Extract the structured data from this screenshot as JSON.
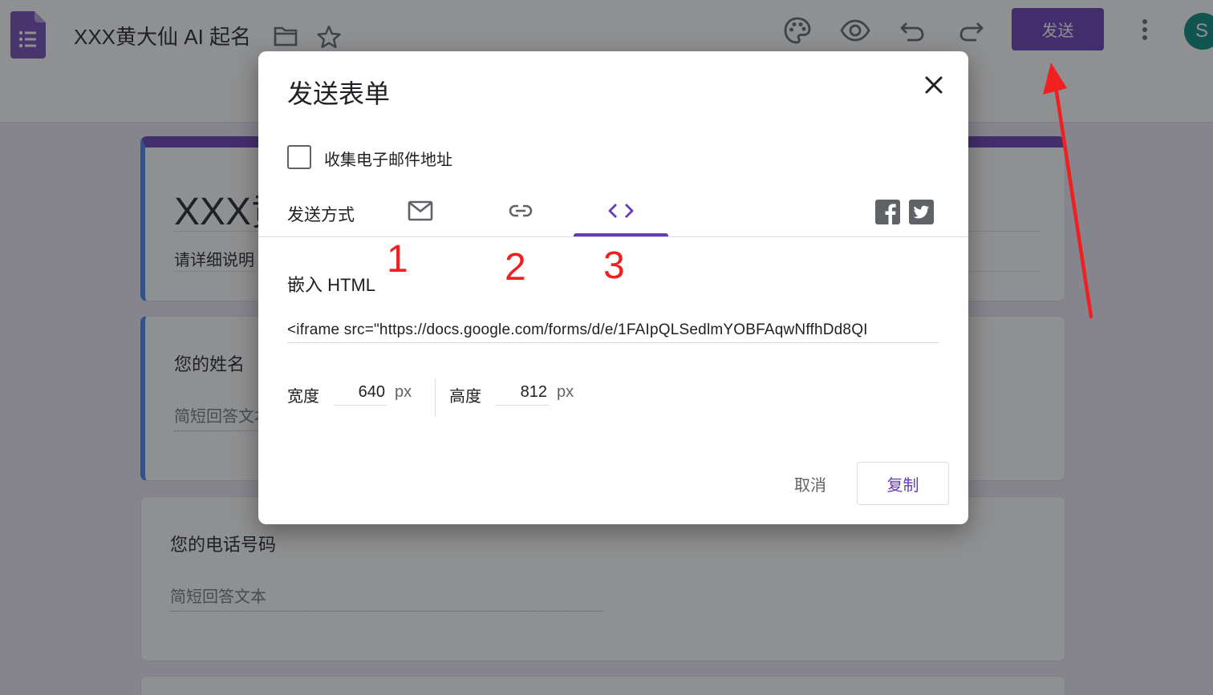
{
  "header": {
    "doc_title": "XXX黄大仙 AI 起名",
    "send_label": "发送",
    "avatar_letter": "S",
    "icons": [
      "forms-app-icon",
      "folder-icon",
      "star-icon",
      "palette-icon",
      "preview-eye-icon",
      "undo-icon",
      "redo-icon",
      "more-vert-icon"
    ]
  },
  "form": {
    "title": "XXX黄大仙 AI 起名",
    "description": "请详细说明",
    "questions": [
      {
        "title": "您的姓名",
        "placeholder": "简短回答文本"
      },
      {
        "title": "您的电话号码",
        "placeholder": "简短回答文本"
      }
    ]
  },
  "dialog": {
    "title": "发送表单",
    "collect_email_label": "收集电子邮件地址",
    "send_via_label": "发送方式",
    "tabs": [
      {
        "name": "email",
        "icon": "mail-icon"
      },
      {
        "name": "link",
        "icon": "link-icon"
      },
      {
        "name": "embed",
        "icon": "code-icon",
        "selected": true
      }
    ],
    "social": [
      "facebook-icon",
      "twitter-icon"
    ],
    "embed_label": "嵌入 HTML",
    "embed_code": "<iframe src=\"https://docs.google.com/forms/d/e/1FAIpQLSedlmYOBFAqwNffhDd8QI",
    "width_label": "宽度",
    "width_value": "640",
    "height_label": "高度",
    "height_value": "812",
    "unit": "px",
    "cancel_label": "取消",
    "copy_label": "复制"
  },
  "annotations": {
    "num1": "1",
    "num2": "2",
    "num3": "3",
    "color": "#f02020"
  },
  "colors": {
    "accent": "#673ab7",
    "background": "#ede7f6",
    "active_question_bar": "#4285f4"
  }
}
